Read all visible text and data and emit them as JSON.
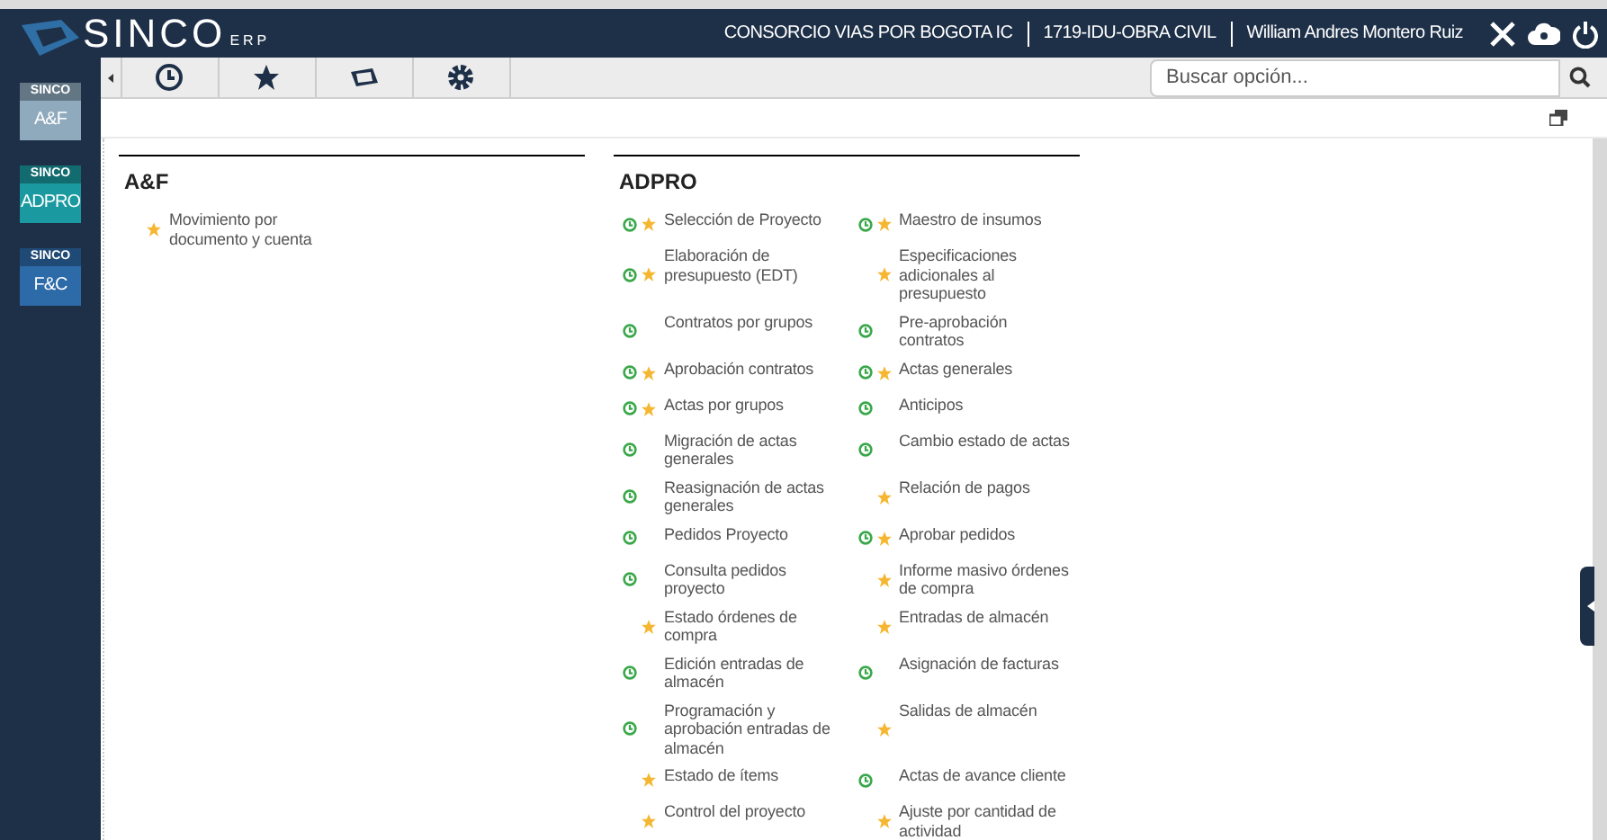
{
  "header": {
    "logo": "SINCO",
    "logo_suffix": "ERP",
    "company": "CONSORCIO VIAS POR BOGOTA IC",
    "project": "1719-IDU-OBRA CIVIL",
    "user": "William Andres Montero Ruiz"
  },
  "modules": [
    {
      "brand": "SINCO",
      "label": "A&F",
      "color": "#8fa9bd"
    },
    {
      "brand": "SINCO",
      "label": "ADPRO",
      "color": "#1a9aa0"
    },
    {
      "brand": "SINCO",
      "label": "F&C",
      "color": "#2d6aa8"
    }
  ],
  "search": {
    "placeholder": "Buscar opción..."
  },
  "groups": [
    {
      "title": "A&F",
      "items": [
        {
          "label": "Movimiento por documento y cuenta",
          "recent": false,
          "favorite": true
        }
      ]
    },
    {
      "title": "ADPRO",
      "items": [
        {
          "label": "Selección de Proyecto",
          "recent": true,
          "favorite": true
        },
        {
          "label": "Maestro de insumos",
          "recent": true,
          "favorite": true
        },
        {
          "label": "Elaboración de presupuesto (EDT)",
          "recent": true,
          "favorite": true
        },
        {
          "label": "Especificaciones adicionales al presupuesto",
          "recent": false,
          "favorite": true
        },
        {
          "label": "Contratos por grupos",
          "recent": true,
          "favorite": false
        },
        {
          "label": "Pre-aprobación contratos",
          "recent": true,
          "favorite": false
        },
        {
          "label": "Aprobación contratos",
          "recent": true,
          "favorite": true
        },
        {
          "label": "Actas generales",
          "recent": true,
          "favorite": true
        },
        {
          "label": "Actas por grupos",
          "recent": true,
          "favorite": true
        },
        {
          "label": "Anticipos",
          "recent": true,
          "favorite": false
        },
        {
          "label": "Migración de actas generales",
          "recent": true,
          "favorite": false
        },
        {
          "label": "Cambio estado de actas",
          "recent": true,
          "favorite": false
        },
        {
          "label": "Reasignación de actas generales",
          "recent": true,
          "favorite": false
        },
        {
          "label": "Relación de pagos",
          "recent": false,
          "favorite": true
        },
        {
          "label": "Pedidos Proyecto",
          "recent": true,
          "favorite": false
        },
        {
          "label": "Aprobar pedidos",
          "recent": true,
          "favorite": true
        },
        {
          "label": "Consulta pedidos proyecto",
          "recent": true,
          "favorite": false
        },
        {
          "label": "Informe masivo órdenes de compra",
          "recent": false,
          "favorite": true
        },
        {
          "label": "Estado órdenes de compra",
          "recent": false,
          "favorite": true
        },
        {
          "label": "Entradas de almacén",
          "recent": false,
          "favorite": true
        },
        {
          "label": "Edición entradas de almacén",
          "recent": true,
          "favorite": false
        },
        {
          "label": "Asignación de facturas",
          "recent": true,
          "favorite": false
        },
        {
          "label": "Programación y aprobación entradas de almacén",
          "recent": true,
          "favorite": false
        },
        {
          "label": "Salidas de almacén",
          "recent": false,
          "favorite": true
        },
        {
          "label": "Estado de ítems",
          "recent": false,
          "favorite": true
        },
        {
          "label": "Actas de avance cliente",
          "recent": true,
          "favorite": false
        },
        {
          "label": "Control del proyecto",
          "recent": false,
          "favorite": true
        },
        {
          "label": "Ajuste por cantidad de actividad",
          "recent": false,
          "favorite": true
        }
      ]
    }
  ]
}
